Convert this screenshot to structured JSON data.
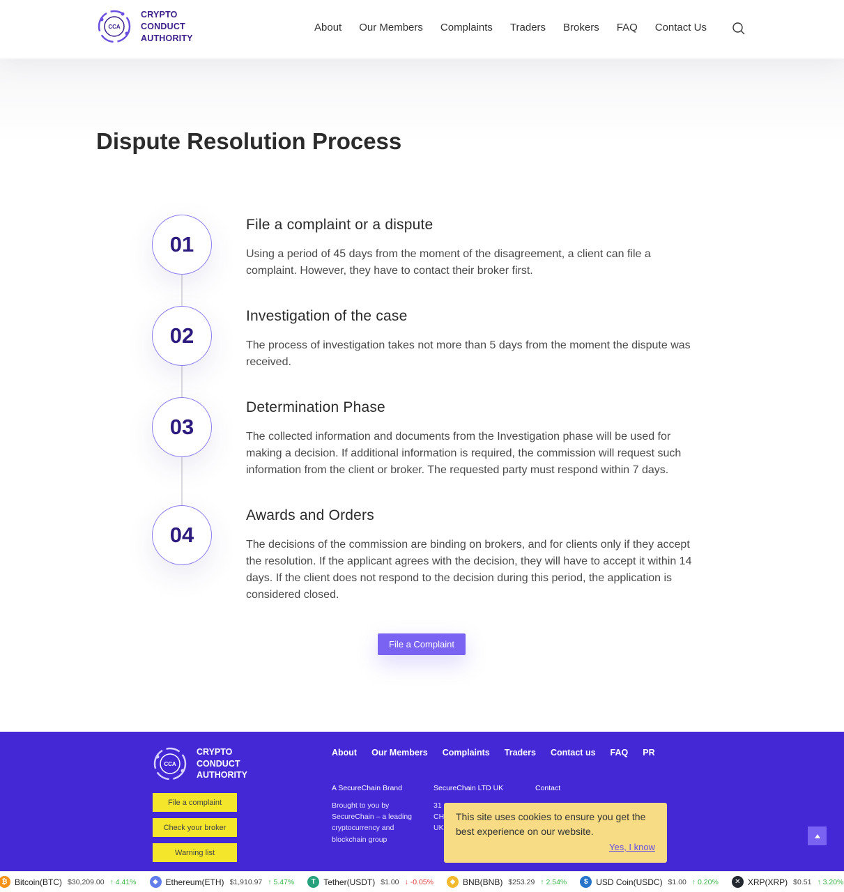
{
  "brand": {
    "line1": "CRYPTO",
    "line2": "CONDUCT",
    "line3": "AUTHORITY",
    "mark": "CCA"
  },
  "nav": [
    "About",
    "Our Members",
    "Complaints",
    "Traders",
    "Brokers",
    "FAQ",
    "Contact Us"
  ],
  "page_title": "Dispute Resolution Process",
  "steps": [
    {
      "num": "01",
      "title": "File a complaint or a dispute",
      "desc": "Using a period of 45 days from the moment of the disagreement, a client can file a complaint. However, they have to contact their broker first."
    },
    {
      "num": "02",
      "title": "Investigation of the case",
      "desc": "The process of investigation takes not more than 5 days from the moment the dispute was received."
    },
    {
      "num": "03",
      "title": "Determination Phase",
      "desc": "The collected information and documents from the Investigation phase will be used for making a decision. If additional information is required, the commission will request such information from the client or broker. The requested party must respond within 7 days."
    },
    {
      "num": "04",
      "title": "Awards and Orders",
      "desc": "The decisions of the commission are binding on brokers, and for clients only if they accept the resolution. If the applicant agrees with the decision, they will have to accept it within 14 days. If the client does not respond to the decision during this period, the application is considered closed."
    }
  ],
  "cta_label": "File a Complaint",
  "footer": {
    "nav": [
      "About",
      "Our Members",
      "Complaints",
      "Traders",
      "Contact us",
      "FAQ",
      "PR"
    ],
    "buttons": [
      "File a complaint",
      "Check your broker",
      "Warning list"
    ],
    "col1_title": "A SecureChain Brand",
    "col1_text": "Brought to you by SecureChain – a leading cryptocurrency and blockchain group",
    "col2_title": "SecureChain LTD UK",
    "col2_text_l1": "31",
    "col2_text_l2": "CH",
    "col2_text_l3": "UK",
    "col3_title": "Contact"
  },
  "cookie": {
    "text": "This site uses cookies to ensure you get the best experience on our website.",
    "link": "Yes, I know"
  },
  "ticker": [
    {
      "name": "Bitcoin(BTC)",
      "price": "$30,209.00",
      "change": "4.41%",
      "dir": "up",
      "color": "#f7931a",
      "glyph": "₿"
    },
    {
      "name": "Ethereum(ETH)",
      "price": "$1,910.97",
      "change": "5.47%",
      "dir": "up",
      "color": "#627eea",
      "glyph": "◆"
    },
    {
      "name": "Tether(USDT)",
      "price": "$1.00",
      "change": "-0.05%",
      "dir": "down",
      "color": "#26a17b",
      "glyph": "T"
    },
    {
      "name": "BNB(BNB)",
      "price": "$253.29",
      "change": "2.54%",
      "dir": "up",
      "color": "#f3ba2f",
      "glyph": "◆"
    },
    {
      "name": "USD Coin(USDC)",
      "price": "$1.00",
      "change": "0.20%",
      "dir": "up",
      "color": "#2775ca",
      "glyph": "$"
    },
    {
      "name": "XRP(XRP)",
      "price": "$0.51",
      "change": "3.20%",
      "dir": "up",
      "color": "#23292f",
      "glyph": "✕"
    }
  ]
}
